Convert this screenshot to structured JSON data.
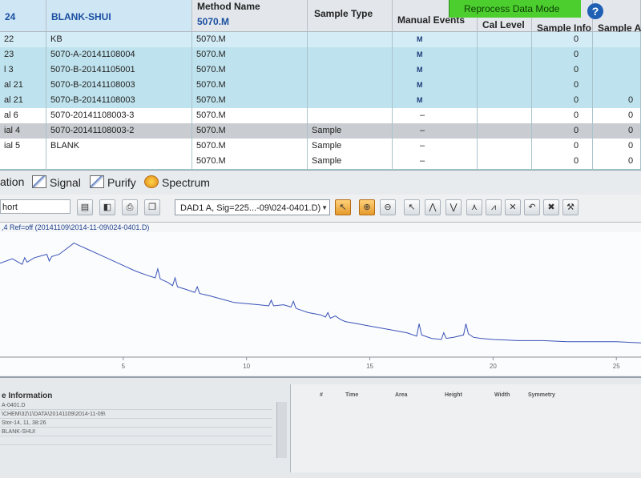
{
  "app": {
    "data_mode_label": "Reprocess Data Mode",
    "help_label": "?"
  },
  "table": {
    "columns": {
      "col1": "24",
      "col2": "BLANK-SHUI",
      "method_name": "Method Name",
      "method_top": "5070.M",
      "sample_type": "Sample Type",
      "manual_events": "Manual Events",
      "cal_level": "Cal Level",
      "sample_info": "Sample Info",
      "sample_amount": "Sample A..."
    },
    "rows": [
      {
        "vial": "22",
        "name": "KB",
        "method": "5070.M",
        "type": "",
        "events": "M",
        "info": "0",
        "amount": ""
      },
      {
        "vial": "23",
        "name": "5070-A-20141108004",
        "method": "5070.M",
        "type": "",
        "events": "M",
        "info": "0",
        "amount": ""
      },
      {
        "vial": "l 3",
        "name": "5070-B-20141105001",
        "method": "5070.M",
        "type": "",
        "events": "M",
        "info": "0",
        "amount": ""
      },
      {
        "vial": "al 21",
        "name": "5070-B-20141108003",
        "method": "5070.M",
        "type": "",
        "events": "M",
        "info": "0",
        "amount": ""
      },
      {
        "vial": "al 21",
        "name": "5070-B-20141108003",
        "method": "5070.M",
        "type": "",
        "events": "M",
        "info": "0",
        "amount": "0"
      },
      {
        "vial": "al 6",
        "name": "5070-20141108003-3",
        "method": "5070.M",
        "type": "",
        "events": "–",
        "info": "0",
        "amount": "0"
      },
      {
        "vial": "ial 4",
        "name": "5070-20141108003-2",
        "method": "5070.M",
        "type": "Sample",
        "events": "–",
        "info": "0",
        "amount": "0"
      },
      {
        "vial": "ial 5",
        "name": "BLANK",
        "method": "5070.M",
        "type": "Sample",
        "events": "–",
        "info": "0",
        "amount": "0"
      },
      {
        "vial": "",
        "name": "",
        "method": "5070.M",
        "type": "Sample",
        "events": "–",
        "info": "0",
        "amount": "0"
      }
    ]
  },
  "tabs": [
    {
      "label": "ation",
      "icon": "none"
    },
    {
      "label": "Signal",
      "icon": "signal-icon"
    },
    {
      "label": "Purify",
      "icon": "purify-icon"
    },
    {
      "label": "Spectrum",
      "icon": "spectrum-icon"
    }
  ],
  "toolbar": {
    "short_field_value": "hort",
    "signal_select_value": "DAD1 A, Sig=225...-09\\024-0401.D)"
  },
  "path_line": ",4 Ref=off (20141109\\2014-11-09\\024-0401.D)",
  "chart_data": {
    "type": "line",
    "title": "",
    "xlabel": "",
    "ylabel": "",
    "x_ticks": [
      5,
      10,
      15,
      20,
      25
    ],
    "xlim": [
      0,
      26
    ],
    "ylim": [
      0,
      100
    ],
    "series": [
      {
        "color": "#3a52b8",
        "x": [
          0.0,
          0.5,
          0.9,
          1.0,
          1.1,
          1.4,
          1.9,
          2.0,
          2.1,
          2.4,
          2.7,
          3.0,
          3.3,
          3.6,
          4.0,
          4.5,
          5.0,
          5.5,
          6.0,
          6.3,
          6.4,
          6.5,
          6.8,
          7.0,
          7.1,
          7.2,
          7.5,
          7.9,
          8.0,
          8.1,
          8.5,
          9.0,
          9.5,
          10.0,
          10.5,
          10.9,
          11.0,
          11.1,
          11.5,
          11.8,
          11.9,
          12.0,
          12.1,
          12.5,
          13.0,
          13.2,
          13.3,
          13.4,
          13.6,
          13.8,
          14.0,
          14.5,
          15.0,
          15.5,
          16.0,
          16.5,
          16.9,
          17.0,
          17.1,
          17.5,
          17.9,
          18.0,
          18.1,
          18.4,
          18.8,
          18.9,
          19.0,
          19.2,
          19.5,
          20.0,
          21.0,
          22.0,
          23.0,
          24.0,
          25.0,
          26.0
        ],
        "y": [
          78,
          82,
          77,
          83,
          79,
          83,
          86,
          80,
          84,
          86,
          91,
          96,
          93,
          90,
          86,
          81,
          76,
          71,
          67,
          65,
          73,
          64,
          61,
          58,
          65,
          57,
          55,
          52,
          57,
          51,
          49,
          46,
          43,
          42,
          41,
          40,
          45,
          40,
          41,
          39,
          44,
          38,
          37,
          34,
          32,
          30,
          34,
          29,
          31,
          28,
          26,
          24,
          22,
          20,
          18,
          16,
          13,
          24,
          14,
          11,
          10,
          16,
          11,
          12,
          14,
          24,
          15,
          12,
          11,
          10,
          9,
          9,
          8,
          8,
          8,
          7
        ]
      }
    ]
  },
  "info_panel": {
    "title": "e Information",
    "lines": [
      "A-0401.D",
      "\\CHEM\\32\\1\\DATA\\20141109\\2014-11-09\\",
      "Stor-14, 11, 38:26",
      "BLANK-SHUI",
      ""
    ]
  },
  "peak_table": {
    "headers": [
      "#",
      "Time",
      "Area",
      "Height",
      "Width",
      "Symmetry"
    ]
  }
}
